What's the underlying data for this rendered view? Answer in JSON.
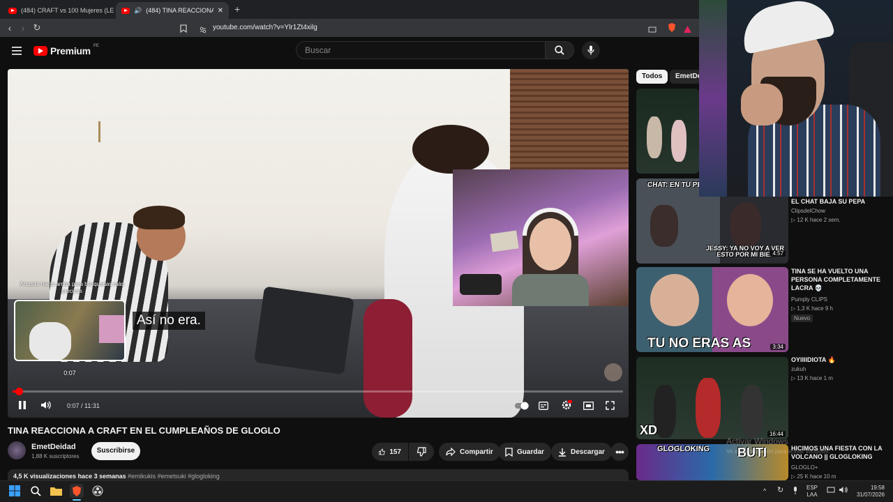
{
  "browser": {
    "tabs": [
      {
        "title": "(484) CRAFT vs 100 Mujeres (LE ROB(",
        "active": false
      },
      {
        "title": "(484) TINA REACCIONA A CR/",
        "active": true
      }
    ],
    "new_tab_icon": "plus-icon",
    "url": "youtube.com/watch?v=Ylr1Zt4xilg"
  },
  "youtube": {
    "logo_text": "Premium",
    "logo_region": "PE",
    "search_placeholder": "Buscar"
  },
  "player": {
    "subtitle": "Así no era.",
    "preview_hint": "Arrastra hacia arriba para búsquedas más precisas",
    "preview_time": "0:07",
    "time_display": "0:07 / 11:31",
    "progress": 0.01
  },
  "video": {
    "title": "TINA REACCIONA A CRAFT EN EL CUMPLEAÑOS DE GLOGLO",
    "channel": "EmetDeidad",
    "subscribers": "1,88 K suscriptores",
    "subscribe_label": "Suscribirse",
    "likes": "157",
    "share_label": "Compartir",
    "save_label": "Guardar",
    "download_label": "Descargar",
    "views": "4,5 K visualizaciones",
    "age": "hace 3 semanas",
    "tags": "#emikukis #emetsuki #glogloking"
  },
  "sidebar": {
    "chips": [
      "Todos",
      "EmetDei"
    ],
    "items": [
      {
        "title": "",
        "channel": "",
        "meta": "",
        "duration": "",
        "overlay": ""
      },
      {
        "title": "EL CHAT BAJA SU PEPA",
        "channel": "ClipsdelChow",
        "meta": "▷ 12 K  hace 2 sem.",
        "duration": "4:57",
        "overlay": "JESSY: YA NO VOY A VER ESTO POR MI BIE..",
        "overlay_top": "CHAT: EN TU PE"
      },
      {
        "title": "TINA SE HA VUELTO UNA PERSONA COMPLETAMENTE LACRA 💀",
        "channel": "Pumply CLIPS",
        "meta": "▷ 1,3 K  hace 9 h",
        "badge": "Nuevo",
        "duration": "3:34",
        "overlay": "TU NO ERAS AS"
      },
      {
        "title": "OYIIIIDIOTA 🔥",
        "channel": "zukuh",
        "meta": "▷ 13 K  hace 1 m",
        "duration": "16:44",
        "overlay": "XD"
      },
      {
        "title": "HICIMOS UNA FIESTA CON LA VOLCANO || GLOGLOKING",
        "channel": "GLOGLO+",
        "meta": "▷ 25 K  hace 10 m",
        "overlay": "BUTI",
        "overlay_top": "GLOGLOKING"
      }
    ]
  },
  "watermark": {
    "line1": "Activar Windows",
    "line2": "Ve a Configuración para activar Windows."
  },
  "taskbar": {
    "lang_top": "ESP",
    "lang_bottom": "LAA",
    "time": "19:58",
    "date": "31/07/2026"
  },
  "colors": {
    "accent": "#ff0000",
    "background": "#0f0f0f",
    "pill": "#272727"
  }
}
